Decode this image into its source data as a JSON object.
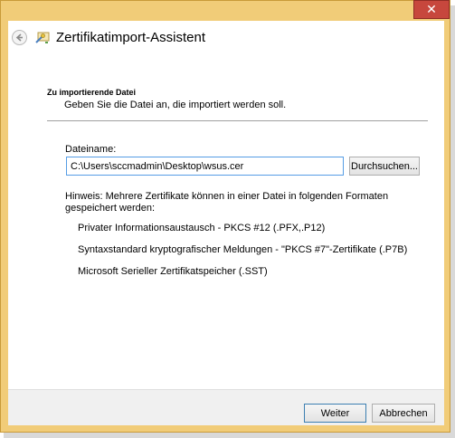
{
  "window": {
    "title": "Zertifikatimport-Assistent",
    "close_symbol": "✕"
  },
  "section": {
    "title": "Zu importierende Datei",
    "description": "Geben Sie die Datei an, die importiert werden soll."
  },
  "file": {
    "label": "Dateiname:",
    "value": "C:\\Users\\sccmadmin\\Desktop\\wsus.cer",
    "browse_label": "Durchsuchen..."
  },
  "hint": "Hinweis: Mehrere Zertifikate können in einer Datei in folgenden Formaten gespeichert werden:",
  "formats": [
    "Privater Informationsaustausch - PKCS #12 (.PFX,.P12)",
    "Syntaxstandard kryptografischer Meldungen - \"PKCS #7\"-Zertifikate (.P7B)",
    "Microsoft Serieller Zertifikatspeicher (.SST)"
  ],
  "footer": {
    "next_label": "Weiter",
    "cancel_label": "Abbrechen"
  },
  "icons": {
    "back": "back-arrow-icon",
    "wizard": "certificate-wizard-icon",
    "close": "close-icon"
  },
  "colors": {
    "frame": "#f1cc78",
    "close_button": "#c7473d",
    "input_focus_border": "#569de5"
  }
}
